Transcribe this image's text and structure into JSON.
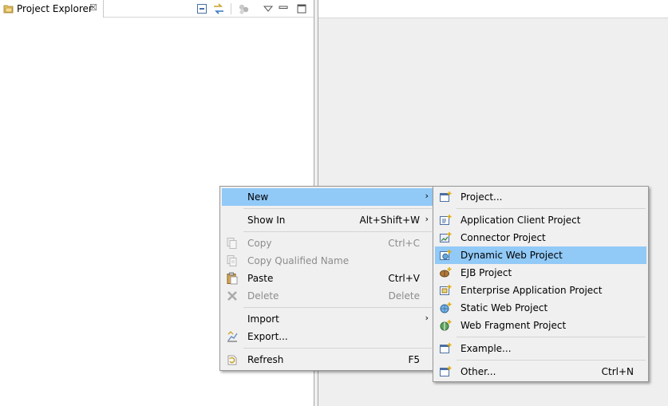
{
  "explorer": {
    "tab_label": "Project Explorer",
    "close_glyph": "☒"
  },
  "context_menu": {
    "items": [
      {
        "label": "New",
        "shortcut": "",
        "submenu": true,
        "enabled": true,
        "icon": "none"
      },
      {
        "label": "Show In",
        "shortcut": "Alt+Shift+W",
        "submenu": true,
        "enabled": true,
        "icon": "none"
      },
      {
        "label": "Copy",
        "shortcut": "Ctrl+C",
        "submenu": false,
        "enabled": false,
        "icon": "copy-icon"
      },
      {
        "label": "Copy Qualified Name",
        "shortcut": "",
        "submenu": false,
        "enabled": false,
        "icon": "copy-qualified-icon"
      },
      {
        "label": "Paste",
        "shortcut": "Ctrl+V",
        "submenu": false,
        "enabled": true,
        "icon": "paste-icon"
      },
      {
        "label": "Delete",
        "shortcut": "Delete",
        "submenu": false,
        "enabled": false,
        "icon": "delete-icon"
      },
      {
        "label": "Import",
        "shortcut": "",
        "submenu": true,
        "enabled": true,
        "icon": "none"
      },
      {
        "label": "Export...",
        "shortcut": "",
        "submenu": false,
        "enabled": true,
        "icon": "export-icon"
      },
      {
        "label": "Refresh",
        "shortcut": "F5",
        "submenu": false,
        "enabled": true,
        "icon": "refresh-icon"
      }
    ],
    "arrow_glyph": "›"
  },
  "new_submenu": {
    "items": [
      {
        "label": "Project...",
        "shortcut": "",
        "icon": "project-icon"
      },
      {
        "label": "Application Client Project",
        "shortcut": "",
        "icon": "app-client-icon"
      },
      {
        "label": "Connector Project",
        "shortcut": "",
        "icon": "connector-icon"
      },
      {
        "label": "Dynamic Web Project",
        "shortcut": "",
        "icon": "dynamic-web-icon"
      },
      {
        "label": "EJB Project",
        "shortcut": "",
        "icon": "ejb-icon"
      },
      {
        "label": "Enterprise Application Project",
        "shortcut": "",
        "icon": "enterprise-app-icon"
      },
      {
        "label": "Static Web Project",
        "shortcut": "",
        "icon": "static-web-icon"
      },
      {
        "label": "Web Fragment Project",
        "shortcut": "",
        "icon": "web-fragment-icon"
      },
      {
        "label": "Example...",
        "shortcut": "",
        "icon": "example-icon"
      },
      {
        "label": "Other...",
        "shortcut": "Ctrl+N",
        "icon": "other-icon"
      }
    ]
  },
  "colors": {
    "highlight": "#91c9f7",
    "menu_bg": "#f0f0f0",
    "disabled_text": "#8c8c8c"
  }
}
